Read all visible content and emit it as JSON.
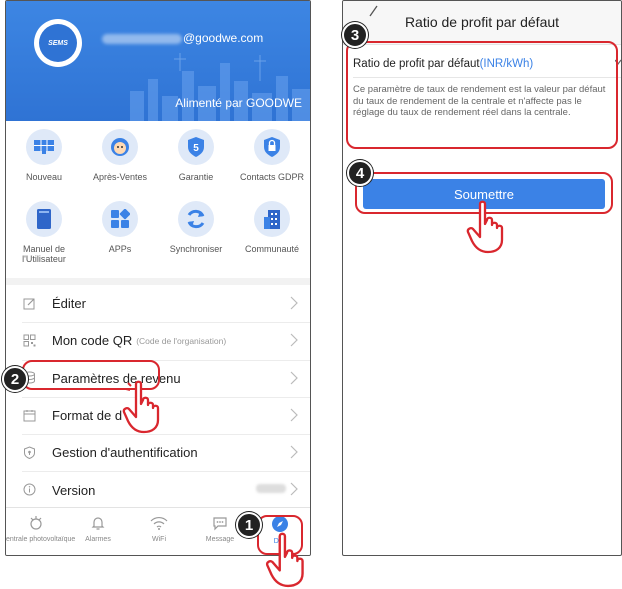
{
  "left": {
    "profile": {
      "email_domain": "@goodwe.com",
      "avatar_label": "SEMS",
      "powered_by": "Alimenté par GOODWE"
    },
    "tiles": [
      {
        "label": "Nouveau",
        "icon": "solar-panel-icon"
      },
      {
        "label": "Après-Ventes",
        "icon": "customer-service-icon"
      },
      {
        "label": "Garantie",
        "icon": "warranty-shield-icon"
      },
      {
        "label": "Contacts GDPR",
        "icon": "gdpr-lock-icon"
      },
      {
        "label": "Manuel de l'Utilisateur",
        "icon": "manual-book-icon"
      },
      {
        "label": "APPs",
        "icon": "apps-grid-icon"
      },
      {
        "label": "Synchroniser",
        "icon": "sync-icon"
      },
      {
        "label": "Communauté",
        "icon": "community-building-icon"
      }
    ],
    "menu": [
      {
        "title": "Éditer",
        "sub": "",
        "icon": "edit-icon"
      },
      {
        "title": "Mon code QR",
        "sub": "(Code de l'organisation)",
        "icon": "qr-code-icon"
      },
      {
        "title": "Paramètres de revenu",
        "sub": "",
        "icon": "coins-icon"
      },
      {
        "title": "Format de d",
        "sub": "",
        "icon": "calendar-icon"
      },
      {
        "title": "Gestion d'authentification",
        "sub": "",
        "icon": "auth-shield-icon"
      },
      {
        "title": "Version",
        "sub": "",
        "icon": "info-icon"
      }
    ],
    "tabs": [
      {
        "label": "entrale photovoltaïque",
        "icon": "plant-icon"
      },
      {
        "label": "Alarmes",
        "icon": "bell-icon"
      },
      {
        "label": "WiFi",
        "icon": "wifi-icon"
      },
      {
        "label": "Message",
        "icon": "message-icon"
      },
      {
        "label": "Déc",
        "icon": "discover-icon"
      }
    ]
  },
  "right": {
    "title": "Ratio de profit par défaut",
    "field_label": "Ratio de profit par défaut",
    "field_unit": "(INR/kWh)",
    "description": "Ce paramètre de taux de rendement est la valeur par défaut du taux de rendement de la centrale et n'affecte pas le réglage du taux de rendement réel dans la centrale.",
    "submit_label": "Soumettre"
  },
  "steps": [
    "1",
    "2",
    "3",
    "4"
  ],
  "colors": {
    "brand_blue": "#2f73d4",
    "accent_blue": "#3b82e6",
    "callout_red": "#d9272e"
  }
}
